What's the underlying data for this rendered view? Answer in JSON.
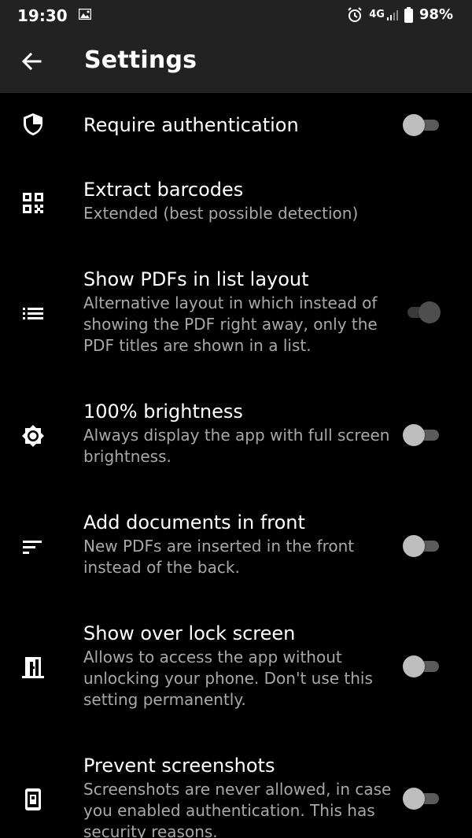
{
  "status_bar": {
    "time": "19:30",
    "network": "4G",
    "battery": "98%"
  },
  "app_bar": {
    "title": "Settings"
  },
  "settings": [
    {
      "title": "Require authentication",
      "summary": "",
      "icon": "shield-icon",
      "toggle": false
    },
    {
      "title": "Extract barcodes",
      "summary": "Extended (best possible detection)",
      "icon": "qr-code-icon"
    },
    {
      "title": "Show PDFs in list layout",
      "summary": "Alternative layout in which instead of showing the PDF right away, only the PDF titles are shown in a list.",
      "icon": "list-icon",
      "toggle": true
    },
    {
      "title": "100% brightness",
      "summary": "Always display the app with full screen brightness.",
      "icon": "brightness-icon",
      "toggle": false
    },
    {
      "title": "Add documents in front",
      "summary": "New PDFs are inserted in the front instead of the back.",
      "icon": "sort-icon",
      "toggle": false
    },
    {
      "title": "Show over lock screen",
      "summary": "Allows to access the app without unlocking your phone. Don't use this setting permanently.",
      "icon": "door-icon",
      "toggle": false
    },
    {
      "title": "Prevent screenshots",
      "summary": "Screenshots are never allowed, in case you enabled authentication. This has security reasons.",
      "icon": "phone-lock-icon",
      "toggle": false
    }
  ]
}
